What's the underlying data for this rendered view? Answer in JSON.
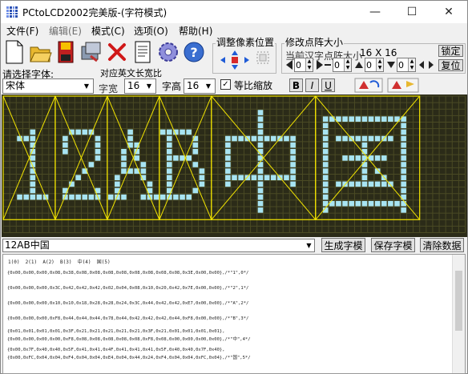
{
  "window": {
    "title": "PCtoLCD2002完美版-(字符模式)",
    "minimize": "—",
    "maximize": "☐",
    "close": "✕"
  },
  "menu": [
    {
      "label": "文件(F)",
      "enabled": true
    },
    {
      "label": "编辑(E)",
      "enabled": false
    },
    {
      "label": "模式(C)",
      "enabled": true
    },
    {
      "label": "选项(O)",
      "enabled": true
    },
    {
      "label": "帮助(H)",
      "enabled": true
    }
  ],
  "toolbar": {
    "tools": [
      "new-file-icon",
      "open-folder-icon",
      "save-disk-icon",
      "generate-icon",
      "delete-cross-icon",
      "notepad-icon",
      "settings-gear-icon",
      "help-icon"
    ],
    "adjust_group_label": "调整像素位置",
    "resize_group": {
      "label": "修改点阵大小",
      "sublabel": "当前汉字点阵大小",
      "dot_size": "16 X 16",
      "lock_button": "锁定",
      "reset_button": "复位",
      "spin_values": [
        "0",
        "0",
        "0",
        "0",
        "0",
        "0"
      ]
    }
  },
  "font_row": {
    "choose_font_label": "请选择字体:",
    "font_value": "宋体",
    "ratio_label": "对应英文长宽比",
    "width_label": "字宽",
    "width_value": "16",
    "height_label": "字高",
    "height_value": "16",
    "proportional_label": "等比缩放",
    "proportional_checked": true,
    "bold": "B",
    "italic": "I",
    "underline": "U"
  },
  "colors": {
    "canvas_bg": "#2b2b18",
    "grid": "#4a4a24",
    "pixel_on": "#a8e4f2",
    "guide": "#f2e400"
  },
  "glyphs": {
    "cells": [
      "1",
      "2",
      "A",
      "B",
      "中",
      "国"
    ]
  },
  "input": {
    "text": "12AB中国"
  },
  "actions": {
    "generate": "生成字模",
    "save": "保存字模",
    "clear": "清除数据"
  },
  "output": {
    "header": "1(0)  2(1)  A(2)  B(3)  中(4)  国(5)",
    "lines": [
      "{0x00,0x00,0x00,0x08,0x38,0x08,0x08,0x08,0x08,0x08,0x08,0x08,0x08,0x3E,0x00,0x00},/*\"1\",0*/",
      "{0x00,0x00,0x00,0x3C,0x42,0x42,0x42,0x02,0x04,0x08,0x10,0x20,0x42,0x7E,0x00,0x00},/*\"2\",1*/",
      "{0x00,0x00,0x00,0x10,0x10,0x18,0x28,0x28,0x24,0x3C,0x44,0x42,0x42,0xE7,0x00,0x00},/*\"A\",2*/",
      "{0x00,0x00,0x00,0xF8,0x44,0x44,0x44,0x78,0x44,0x42,0x42,0x42,0x44,0xF8,0x00,0x00},/*\"B\",3*/",
      "{0x01,0x01,0x01,0x01,0x3F,0x21,0x21,0x21,0x21,0x21,0x3F,0x21,0x01,0x01,0x01,0x01},",
      "{0x00,0x00,0x00,0x00,0xF8,0x08,0x08,0x08,0x08,0x08,0xF8,0x08,0x00,0x00,0x00,0x00},/*\"中\",4*/",
      "{0x00,0x7F,0x40,0x40,0x5F,0x41,0x41,0x4F,0x41,0x41,0x41,0x5F,0x40,0x40,0x7F,0x40},",
      "{0x00,0xFC,0x04,0x04,0xF4,0x04,0x04,0xE4,0x04,0x44,0x24,0xF4,0x04,0x04,0xFC,0x04},/*\"国\",5*/"
    ]
  }
}
